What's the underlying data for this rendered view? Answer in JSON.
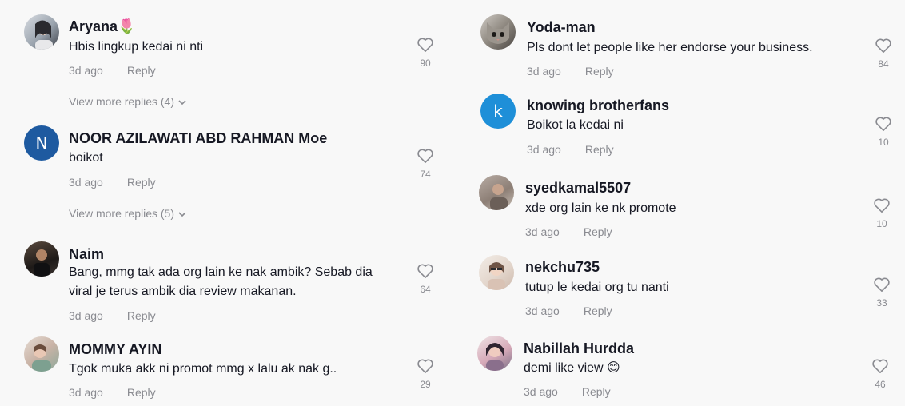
{
  "labels": {
    "reply": "Reply"
  },
  "left_comments": [
    {
      "username": "Aryana🌷",
      "text": [
        "Hbis lingkup kedai ni nti"
      ],
      "time": "3d ago",
      "likes": "90",
      "view_more": "View more replies (4)",
      "avatar_icon": "photo-avatar"
    },
    {
      "username": "NOOR AZILAWATI ABD RAHMAN Moe",
      "text": [
        "boikot"
      ],
      "time": "3d ago",
      "likes": "74",
      "view_more": "View more replies (5)",
      "avatar_letter": "N",
      "avatar_color": "#1e5aa0"
    },
    {
      "username": "Naim",
      "text": [
        "Bang, mmg tak ada org lain ke nak ambik? Sebab dia",
        "viral je terus ambik dia review makanan."
      ],
      "time": "3d ago",
      "likes": "64",
      "avatar_icon": "photo-avatar"
    },
    {
      "username": "MOMMY AYIN",
      "text": [
        "Tgok muka akk ni promot mmg x lalu ak nak g.."
      ],
      "time": "3d ago",
      "likes": "29",
      "avatar_icon": "photo-avatar"
    }
  ],
  "right_comments": [
    {
      "username": "Yoda-man",
      "text": [
        "Pls dont let people like her endorse your business."
      ],
      "time": "3d ago",
      "likes": "84",
      "avatar_icon": "cat-photo-avatar"
    },
    {
      "username": "knowing brotherfans",
      "text": [
        "Boikot la kedai ni"
      ],
      "time": "3d ago",
      "likes": "10",
      "avatar_letter": "k",
      "avatar_color": "#1e8fd8"
    },
    {
      "username": "syedkamal5507",
      "text": [
        "xde org lain ke nk promote"
      ],
      "time": "3d ago",
      "likes": "10",
      "avatar_icon": "photo-avatar"
    },
    {
      "username": "nekchu735",
      "text": [
        "tutup le kedai org tu nanti"
      ],
      "time": "3d ago",
      "likes": "33",
      "avatar_icon": "photo-avatar"
    },
    {
      "username": "Nabillah Hurdda",
      "text": [
        "demi like view 😊"
      ],
      "time": "3d ago",
      "likes": "46",
      "avatar_icon": "photo-avatar"
    }
  ]
}
